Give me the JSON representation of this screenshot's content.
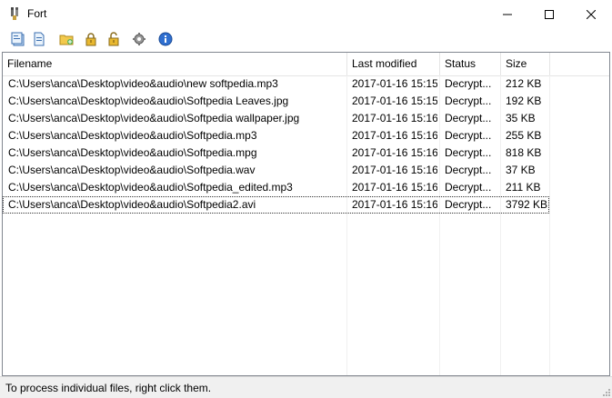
{
  "window": {
    "title": "Fort"
  },
  "toolbar": {
    "icons": [
      "add-files-icon",
      "add-file-icon",
      "add-folder-icon",
      "encrypt-icon",
      "decrypt-icon",
      "settings-icon",
      "info-icon"
    ]
  },
  "columns": [
    "Filename",
    "Last modified",
    "Status",
    "Size"
  ],
  "rows": [
    {
      "filename": "C:\\Users\\anca\\Desktop\\video&audio\\new softpedia.mp3",
      "modified": "2017-01-16 15:15",
      "status": "Decrypt...",
      "size": "212 KB"
    },
    {
      "filename": "C:\\Users\\anca\\Desktop\\video&audio\\Softpedia Leaves.jpg",
      "modified": "2017-01-16 15:15",
      "status": "Decrypt...",
      "size": "192 KB"
    },
    {
      "filename": "C:\\Users\\anca\\Desktop\\video&audio\\Softpedia wallpaper.jpg",
      "modified": "2017-01-16 15:16",
      "status": "Decrypt...",
      "size": "35 KB"
    },
    {
      "filename": "C:\\Users\\anca\\Desktop\\video&audio\\Softpedia.mp3",
      "modified": "2017-01-16 15:16",
      "status": "Decrypt...",
      "size": "255 KB"
    },
    {
      "filename": "C:\\Users\\anca\\Desktop\\video&audio\\Softpedia.mpg",
      "modified": "2017-01-16 15:16",
      "status": "Decrypt...",
      "size": "818 KB"
    },
    {
      "filename": "C:\\Users\\anca\\Desktop\\video&audio\\Softpedia.wav",
      "modified": "2017-01-16 15:16",
      "status": "Decrypt...",
      "size": "37 KB"
    },
    {
      "filename": "C:\\Users\\anca\\Desktop\\video&audio\\Softpedia_edited.mp3",
      "modified": "2017-01-16 15:16",
      "status": "Decrypt...",
      "size": "211 KB"
    },
    {
      "filename": "C:\\Users\\anca\\Desktop\\video&audio\\Softpedia2.avi",
      "modified": "2017-01-16 15:16",
      "status": "Decrypt...",
      "size": "3792 KB"
    }
  ],
  "statusbar": {
    "text": "To process individual files, right click them."
  }
}
